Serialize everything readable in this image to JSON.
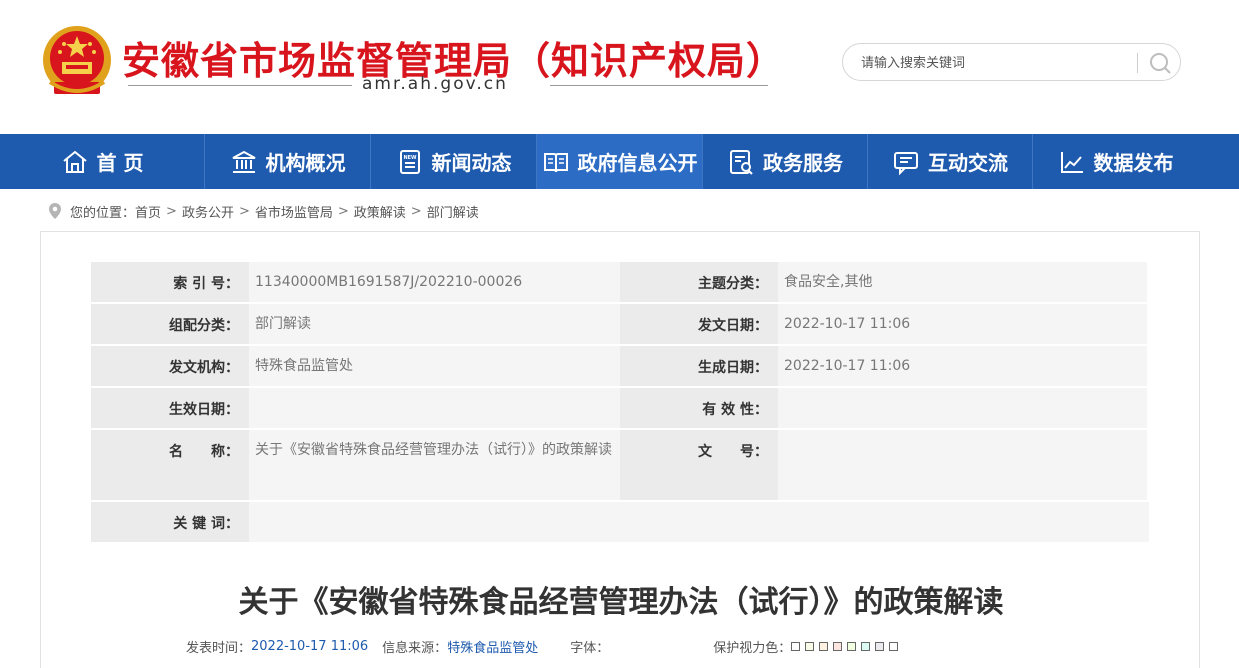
{
  "header": {
    "site_title": "安徽省市场监督管理局（知识产权局）",
    "domain": "amr.ah.gov.cn",
    "search_placeholder": "请输入搜索关键词"
  },
  "nav": {
    "items": [
      {
        "label": "首 页",
        "icon": "home-icon"
      },
      {
        "label": "机构概况",
        "icon": "institution-icon"
      },
      {
        "label": "新闻动态",
        "icon": "news-icon"
      },
      {
        "label": "政府信息公开",
        "icon": "book-icon",
        "active": true
      },
      {
        "label": "政务服务",
        "icon": "service-icon"
      },
      {
        "label": "互动交流",
        "icon": "chat-icon"
      },
      {
        "label": "数据发布",
        "icon": "chart-icon"
      }
    ]
  },
  "breadcrumb": {
    "prefix": "您的位置：",
    "items": [
      "首页",
      "政务公开",
      "省市场监管局",
      "政策解读",
      "部门解读"
    ],
    "separator": ">"
  },
  "meta": {
    "index_no_label": "索 引 号：",
    "index_no": "11340000MB1691587J/202210-00026",
    "topic_label": "主题分类：",
    "topic": "食品安全,其他",
    "group_label": "组配分类：",
    "group": "部门解读",
    "issue_date_label": "发文日期：",
    "issue_date": "2022-10-17 11:06",
    "issuer_label": "发文机构：",
    "issuer": "特殊食品监管处",
    "created_label": "生成日期：",
    "created": "2022-10-17 11:06",
    "effective_label": "生效日期：",
    "effective": "",
    "validity_label": "有 效 性：",
    "validity": "",
    "name_label": "名　　称：",
    "name": "关于《安徽省特殊食品经营管理办法（试行）》的政策解读",
    "doc_no_label": "文　　号：",
    "doc_no": "",
    "keywords_label": "关 键 词：",
    "keywords": ""
  },
  "article": {
    "title": "关于《安徽省特殊食品经营管理办法（试行）》的政策解读",
    "publish_label": "发表时间：",
    "publish_time": "2022-10-17 11:06",
    "source_label": "信息来源：",
    "source": "特殊食品监管处",
    "font_label": "字体：",
    "eye_label": "保护视力色："
  },
  "colors": {
    "brand_red": "#d8141d",
    "nav_blue": "#1e5aae",
    "nav_active": "#2d6cc4",
    "eye_swatches": [
      "#ffffff",
      "#fafbe6",
      "#fff2e2",
      "#fde6e0",
      "#f3ffe1",
      "#dafaf3",
      "#eaeaef",
      "#ffffff"
    ]
  }
}
